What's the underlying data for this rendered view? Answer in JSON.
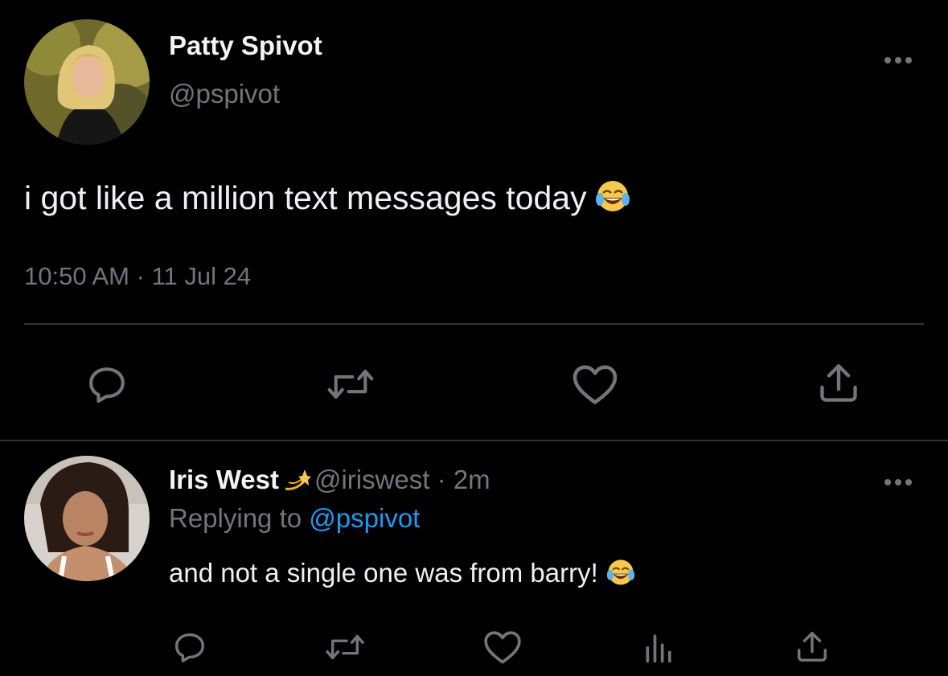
{
  "tweet": {
    "author": {
      "display_name": "Patty Spivot",
      "handle": "@pspivot",
      "avatar_icon": "avatar-photo-icon"
    },
    "text": "i got like a million text messages today",
    "emoji_icon": "tears-of-joy-emoji-icon",
    "time": "10:50 AM",
    "separator": "·",
    "date": "11 Jul 24",
    "actions": [
      "reply-icon",
      "retweet-icon",
      "like-icon",
      "share-icon"
    ]
  },
  "reply": {
    "author": {
      "display_name": "Iris West",
      "name_emoji_icon": "dizzy-emoji-icon",
      "handle": "@iriswest",
      "separator": "·",
      "age": "2m",
      "avatar_icon": "avatar-photo-icon"
    },
    "replying_prefix": "Replying to",
    "replying_to": "@pspivot",
    "text": "and not a single one was from barry!",
    "emoji_icon": "tears-of-joy-emoji-icon",
    "actions": [
      "reply-icon",
      "retweet-icon",
      "like-icon",
      "views-icon",
      "share-icon"
    ]
  },
  "colors": {
    "background": "#000000",
    "primary_text": "#e7e9ea",
    "secondary_text": "#71767b",
    "link": "#1d9bf0",
    "divider": "#2f3336"
  }
}
